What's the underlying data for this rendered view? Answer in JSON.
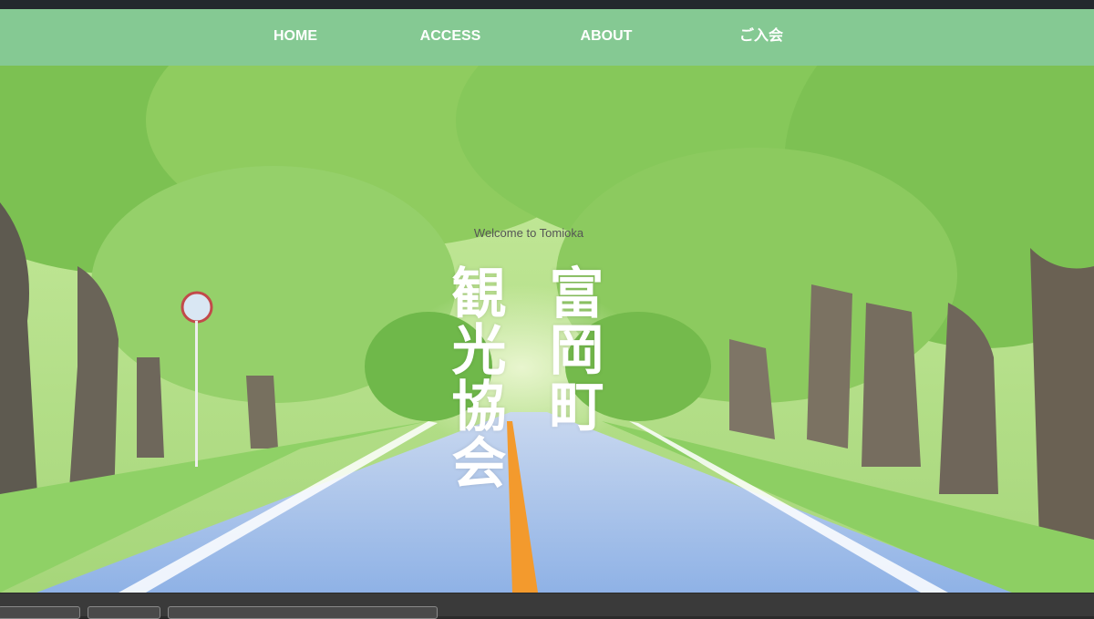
{
  "nav": {
    "items": [
      {
        "label": "HOME"
      },
      {
        "label": "ACCESS"
      },
      {
        "label": "ABOUT"
      },
      {
        "label": "ご入会"
      }
    ]
  },
  "hero": {
    "welcome": "Welcome to Tomioka",
    "title_right": "富岡町",
    "title_left": "観光協会"
  },
  "colors": {
    "nav_bg": "#85c993",
    "nav_text": "#ffffff",
    "road_line": "#f39a2d"
  }
}
